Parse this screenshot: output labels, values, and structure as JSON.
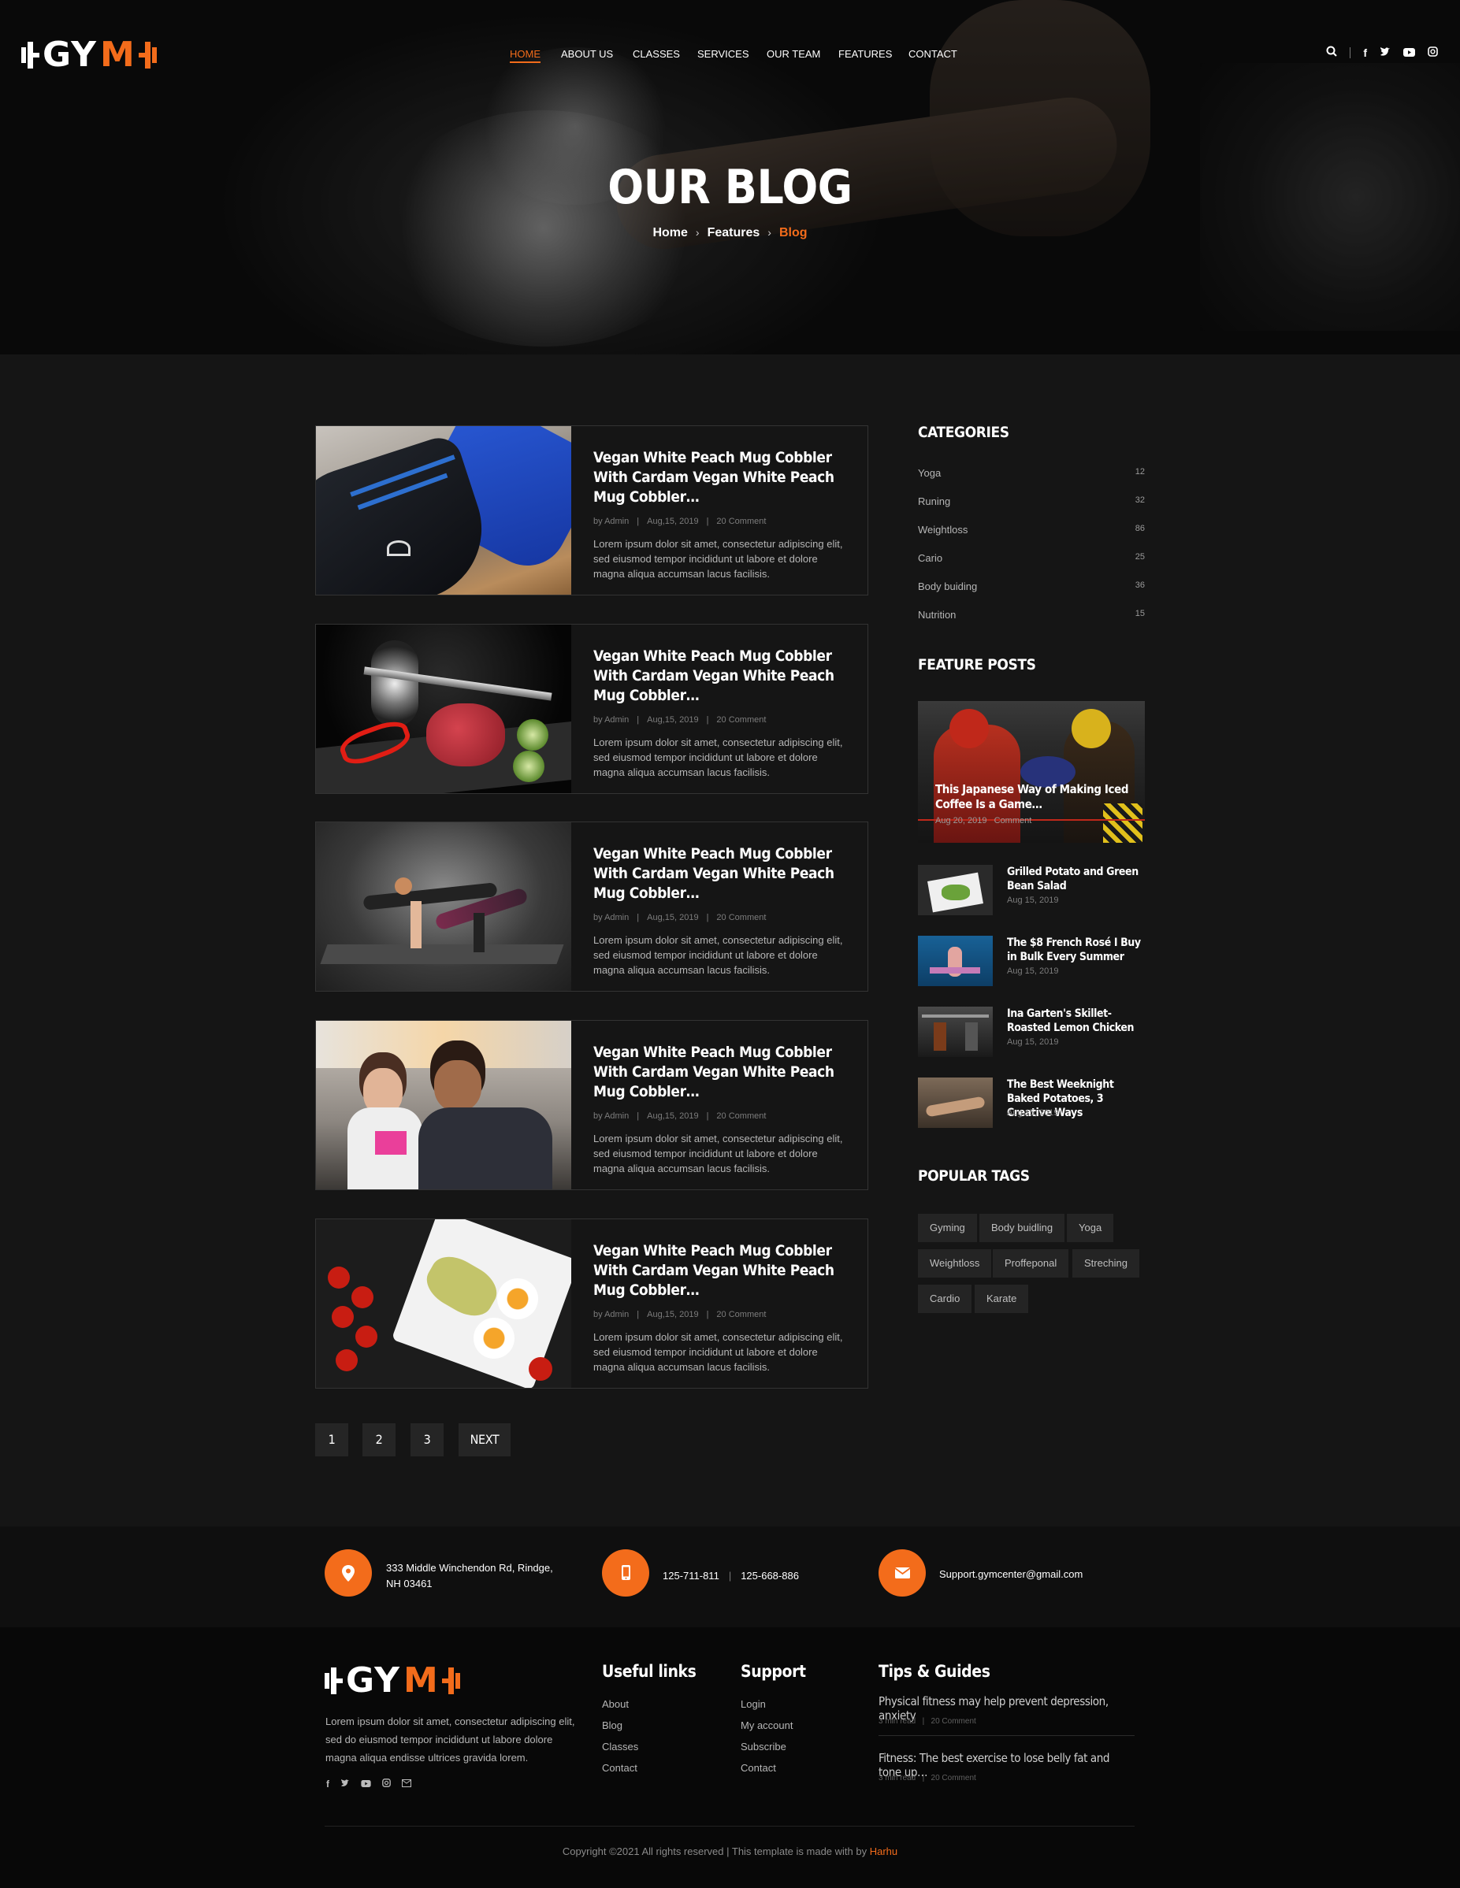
{
  "brand": {
    "logo_text_white": "GY",
    "logo_text_orange": "M",
    "accent_color": "#f36c1b"
  },
  "nav": {
    "items": [
      "HOME",
      "ABOUT US",
      "CLASSES",
      "SERVICES",
      "OUR TEAM",
      "FEATURES",
      "CONTACT"
    ],
    "active": "HOME"
  },
  "hero": {
    "title": "OUR BLOG",
    "crumbs": [
      "Home",
      "Features",
      "Blog"
    ]
  },
  "posts": [
    {
      "title": "Vegan White Peach Mug Cobbler With Cardam Vegan White Peach Mug Cobbler…",
      "author": "by Admin",
      "date": "Aug,15, 2019",
      "comments": "20 Comment",
      "excerpt": "Lorem ipsum dolor sit amet, consectetur adipiscing elit, sed eiusmod tempor incididunt ut labore et dolore magna aliqua accumsan lacus facilisis."
    },
    {
      "title": "Vegan White Peach Mug Cobbler With Cardam Vegan White Peach Mug Cobbler…",
      "author": "by Admin",
      "date": "Aug,15, 2019",
      "comments": "20 Comment",
      "excerpt": "Lorem ipsum dolor sit amet, consectetur adipiscing elit, sed eiusmod tempor incididunt ut labore et dolore magna aliqua accumsan lacus facilisis."
    },
    {
      "title": "Vegan White Peach Mug Cobbler With Cardam Vegan White Peach Mug Cobbler…",
      "author": "by Admin",
      "date": "Aug,15, 2019",
      "comments": "20 Comment",
      "excerpt": "Lorem ipsum dolor sit amet, consectetur adipiscing elit, sed eiusmod tempor incididunt ut labore et dolore magna aliqua accumsan lacus facilisis."
    },
    {
      "title": "Vegan White Peach Mug Cobbler With Cardam Vegan White Peach Mug Cobbler…",
      "author": "by Admin",
      "date": "Aug,15, 2019",
      "comments": "20 Comment",
      "excerpt": "Lorem ipsum dolor sit amet, consectetur adipiscing elit, sed eiusmod tempor incididunt ut labore et dolore magna aliqua accumsan lacus facilisis."
    },
    {
      "title": "Vegan White Peach Mug Cobbler With Cardam Vegan White Peach Mug Cobbler…",
      "author": "by Admin",
      "date": "Aug,15, 2019",
      "comments": "20 Comment",
      "excerpt": "Lorem ipsum dolor sit amet, consectetur adipiscing elit, sed eiusmod tempor incididunt ut labore et dolore magna aliqua accumsan lacus facilisis."
    }
  ],
  "sidebar": {
    "categories_title": "CATEGORIES",
    "categories": [
      {
        "name": "Yoga",
        "count": "12"
      },
      {
        "name": "Runing",
        "count": "32"
      },
      {
        "name": "Weightloss",
        "count": "86"
      },
      {
        "name": "Cario",
        "count": "25"
      },
      {
        "name": "Body buiding",
        "count": "36"
      },
      {
        "name": "Nutrition",
        "count": "15"
      }
    ],
    "feature_title": "FEATURE POSTS",
    "feature_big": {
      "title": "This Japanese Way of Making Iced Coffee Is a Game…",
      "date": "Aug 20, 2019",
      "comments": "Comment"
    },
    "feature_posts": [
      {
        "title": "Grilled Potato and Green Bean Salad",
        "date": "Aug 15, 2019"
      },
      {
        "title": "The $8 French Rosé I Buy in Bulk Every Summer",
        "date": "Aug 15, 2019"
      },
      {
        "title": "Ina Garten's Skillet-Roasted Lemon Chicken",
        "date": "Aug 15, 2019"
      },
      {
        "title": "The Best Weeknight Baked Potatoes, 3 Creative Ways",
        "date": "Aug 15, 2019"
      }
    ],
    "tags_title": "POPULAR TAGS",
    "tags": [
      "Gyming",
      "Body buidling",
      "Yoga",
      "Weightloss",
      "Proffeponal",
      "Streching",
      "Cardio",
      "Karate"
    ]
  },
  "pagination": [
    "1",
    "2",
    "3",
    "NEXT"
  ],
  "contact": {
    "address_line1": "333 Middle Winchendon Rd, Rindge,",
    "address_line2": "NH 03461",
    "phone1": "125-711-811",
    "phone_sep": "|",
    "phone2": "125-668-886",
    "email": "Support.gymcenter@gmail.com"
  },
  "footer": {
    "about": "Lorem ipsum dolor sit amet, consectetur adipiscing elit, sed do eiusmod tempor incididunt ut labore dolore magna aliqua endisse ultrices gravida lorem.",
    "useful_title": "Useful links",
    "useful": [
      "About",
      "Blog",
      "Classes",
      "Contact"
    ],
    "support_title": "Support",
    "support": [
      "Login",
      "My account",
      "Subscribe",
      "Contact"
    ],
    "tips_title": "Tips & Guides",
    "tips": [
      {
        "title": "Physical fitness may help prevent depression, anxiety",
        "read": "3 min read",
        "comments": "20 Comment"
      },
      {
        "title": "Fitness: The best exercise to lose belly fat and tone up…",
        "read": "3 min read",
        "comments": "20 Comment"
      }
    ],
    "copyright": "Copyright ©2021 All rights reserved | This template is made with by",
    "credit": "Harhu"
  }
}
